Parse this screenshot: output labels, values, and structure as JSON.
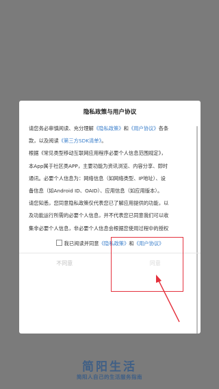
{
  "dialog": {
    "title": "隐私政策与用户协议",
    "rows": [
      [
        "请您务必审慎阅读、充分理解",
        "《隐私政策》",
        "和",
        "《用户协议》",
        "各条"
      ],
      [
        "款，以及阅读",
        "《第三方SDK清单》",
        "。"
      ],
      [
        "根据《常见类型移动互联网应用程序必要个人信息范围规定》，"
      ],
      [
        "本App属于社区类APP，主要功能为资讯浏览、内容分享、即时"
      ],
      [
        "通讯。必要个人信息为：网络信息（如网络类型、IP地址）、设"
      ],
      [
        "备信息（如Android ID、OAID）、应用信息（如应用版本）。"
      ],
      [
        "请您知悉，您同意隐私政策仅代表您已了解应用提供的功能，以"
      ],
      [
        "及功能运行所需的必要个人信息，并不代表您已同意我们可以收"
      ],
      [
        "集非必要个人信息，非必要个人信息会根据您使用过程中的授权"
      ]
    ],
    "agree_prefix": "我已阅读并同意",
    "privacy_link": "《隐私政策》",
    "and_text": "和",
    "user_agreement_link": "《用户协议》",
    "disagree_label": "不同意",
    "agree_label": "同意"
  },
  "brand": {
    "logo_text": "简阳生活",
    "slogan": "简阳人自己的生活服务指南"
  },
  "colors": {
    "link": "#3b7fcb",
    "annotation": "#e4303c",
    "brand": "#3f5f86"
  }
}
